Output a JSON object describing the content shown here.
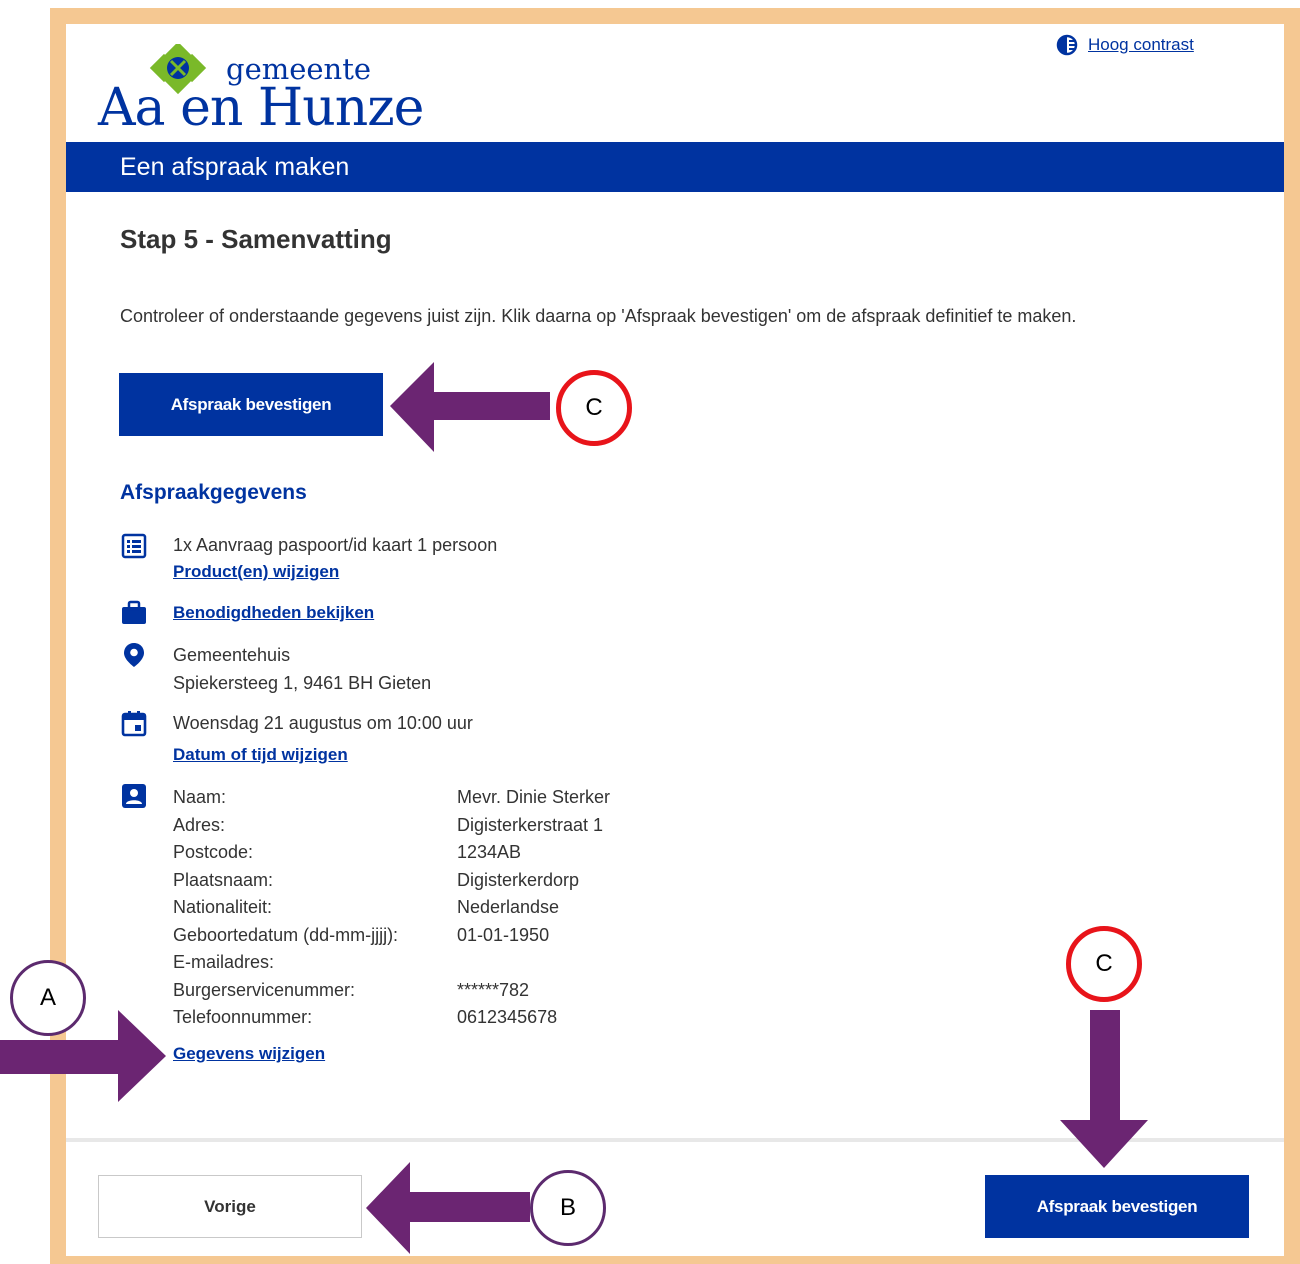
{
  "header": {
    "contrast_link": "Hoog contrast",
    "logo_small": "gemeente",
    "logo_big": "Aa en Hunze",
    "bar_title": "Een afspraak maken"
  },
  "main": {
    "step_title": "Stap 5 - Samenvatting",
    "intro": "Controleer of onderstaande gegevens juist zijn. Klik daarna op 'Afspraak bevestigen' om de afspraak definitief te maken.",
    "confirm_button": "Afspraak bevestigen",
    "section_title": "Afspraakgegevens",
    "product": {
      "icon": "list-icon",
      "text": "1x Aanvraag paspoort/id kaart 1 persoon",
      "link": "Product(en) wijzigen"
    },
    "requirements": {
      "icon": "briefcase-icon",
      "link": "Benodigdheden bekijken"
    },
    "location": {
      "icon": "location-pin-icon",
      "name": "Gemeentehuis",
      "address": "Spiekersteeg 1, 9461 BH Gieten"
    },
    "datetime": {
      "icon": "calendar-icon",
      "text": "Woensdag 21 augustus om 10:00 uur",
      "link": "Datum of tijd wijzigen"
    },
    "personal": {
      "icon": "contact-card-icon",
      "rows": [
        {
          "label": "Naam:",
          "value": "Mevr. Dinie Sterker"
        },
        {
          "label": "Adres:",
          "value": "Digisterkerstraat 1"
        },
        {
          "label": "Postcode:",
          "value": "1234AB"
        },
        {
          "label": "Plaatsnaam:",
          "value": "Digisterkerdorp"
        },
        {
          "label": "Nationaliteit:",
          "value": "Nederlandse"
        },
        {
          "label": "Geboortedatum (dd-mm-jjjj):",
          "value": "01-01-1950"
        },
        {
          "label": "E-mailadres:",
          "value": ""
        },
        {
          "label": "Burgerservicenummer:",
          "value": "******782"
        },
        {
          "label": "Telefoonnummer:",
          "value": "0612345678"
        }
      ],
      "link": "Gegevens wijzigen"
    }
  },
  "footer": {
    "back_button": "Vorige",
    "confirm_button": "Afspraak bevestigen"
  },
  "annotations": {
    "marker_a": "A",
    "marker_b": "B",
    "marker_c_top": "C",
    "marker_c_bottom": "C",
    "arrow_color": "#6b2572",
    "circle_red": "#e8141a"
  }
}
